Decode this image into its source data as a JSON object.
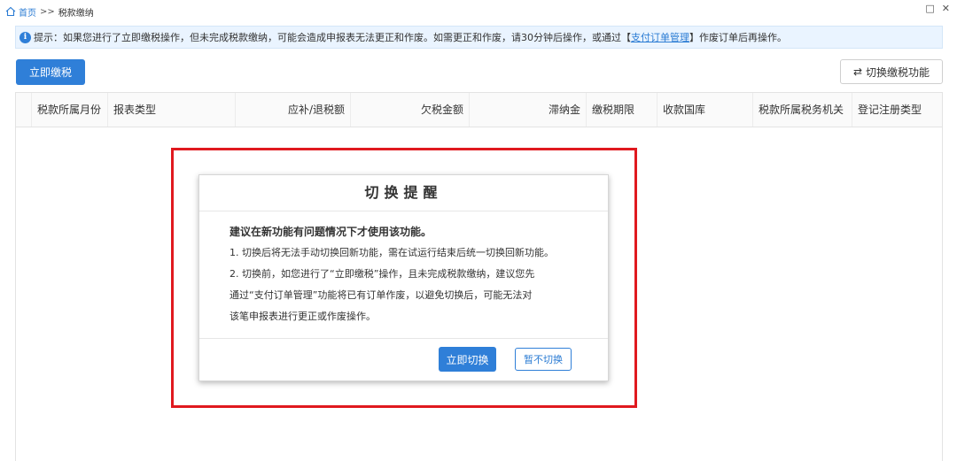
{
  "breadcrumb": {
    "home": "首页",
    "separator": ">>",
    "current": "税款缴纳"
  },
  "window": {
    "restore": "□",
    "close": "✕"
  },
  "notice": {
    "icon": "i",
    "text_before": "提示：如果您进行了立即缴税操作，但未完成税款缴纳，可能会造成申报表无法更正和作废。如需更正和作废，请30分钟后操作，或通过【",
    "link": "支付订单管理",
    "text_after": "】作废订单后再操作。"
  },
  "toolbar": {
    "pay_now": "立即缴税",
    "switch_function": "切换缴税功能",
    "switch_icon": "⇄"
  },
  "table": {
    "columns": [
      "税款所属月份",
      "报表类型",
      "应补/退税额",
      "欠税金额",
      "滞纳金",
      "缴税期限",
      "收款国库",
      "税款所属税务机关",
      "登记注册类型"
    ]
  },
  "modal": {
    "title": "切换提醒",
    "lead": "建议在新功能有问题情况下才使用该功能。",
    "line1": "1. 切换后将无法手动切换回新功能，需在试运行结束后统一切换回新功能。",
    "line2": "2. 切换前，如您进行了“立即缴税”操作，且未完成税款缴纳，建议您先",
    "line3": "通过“支付订单管理”功能将已有订单作废，以避免切换后，可能无法对",
    "line4": "该笔申报表进行更正或作废操作。",
    "confirm": "立即切换",
    "cancel": "暂不切换"
  },
  "colors": {
    "accent": "#2f7fd8",
    "highlight": "#e0191f",
    "notice_bg": "#eaf4ff"
  }
}
